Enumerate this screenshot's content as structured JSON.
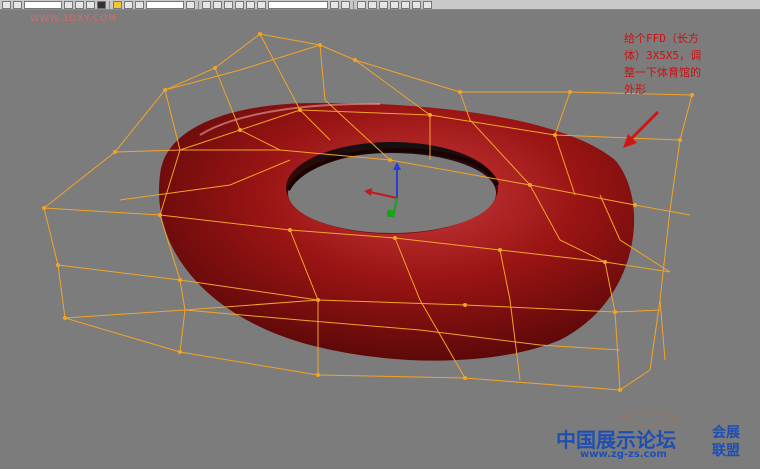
{
  "watermark_top": "WWW.3DXY.COM",
  "annotation": {
    "lines": [
      "给个FFD（长方",
      "体）3X5X5，调",
      "整一下体育馆的",
      "外形"
    ]
  },
  "brand": {
    "name": "中国展示论坛",
    "url": "www.zg-zs.com",
    "side_line1": "会展",
    "side_line2": "联盟"
  },
  "colors": {
    "viewport_bg": "#7c7c7c",
    "lattice": "#f2a428",
    "torus": "#8f1111",
    "annotation_text": "#cc1111",
    "brand": "#1f4fb0"
  },
  "icons": {
    "arrow": "red-arrow-icon",
    "gizmo": "transform-gizmo-icon"
  }
}
